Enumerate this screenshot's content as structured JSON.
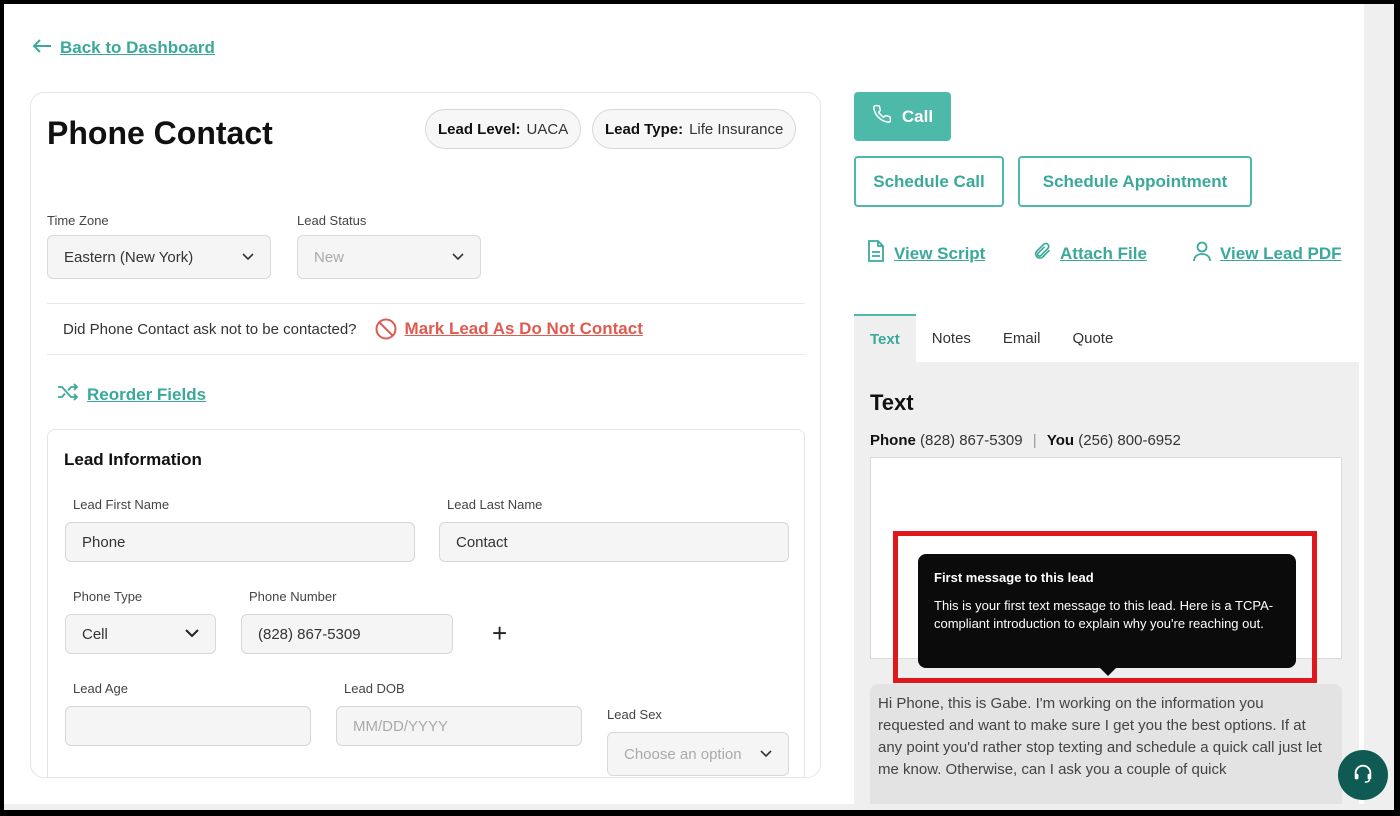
{
  "nav": {
    "back_label": "Back to Dashboard"
  },
  "lead": {
    "title": "Phone Contact",
    "level_label": "Lead Level:",
    "level_value": "UACA",
    "type_label": "Lead Type:",
    "type_value": "Life Insurance"
  },
  "fields": {
    "timezone_label": "Time Zone",
    "timezone_value": "Eastern (New York)",
    "status_label": "Lead Status",
    "status_value": "New"
  },
  "dnc": {
    "question": "Did Phone Contact ask not to be contacted?",
    "action": "Mark Lead As Do Not Contact"
  },
  "reorder_label": "Reorder Fields",
  "lead_info": {
    "title": "Lead Information",
    "first_name_label": "Lead First Name",
    "first_name_value": "Phone",
    "last_name_label": "Lead Last Name",
    "last_name_value": "Contact",
    "phone_type_label": "Phone Type",
    "phone_type_value": "Cell",
    "phone_number_label": "Phone Number",
    "phone_number_value": "(828) 867-5309",
    "add_phone": "+",
    "age_label": "Lead Age",
    "age_value": "",
    "dob_label": "Lead DOB",
    "dob_placeholder": "MM/DD/YYYY",
    "sex_label": "Lead Sex",
    "sex_placeholder": "Choose an option"
  },
  "actions": {
    "call": "Call",
    "schedule_call": "Schedule Call",
    "schedule_appointment": "Schedule Appointment",
    "view_script": "View Script",
    "attach_file": "Attach File",
    "view_lead_pdf": "View Lead PDF"
  },
  "tabs": [
    "Text",
    "Notes",
    "Email",
    "Quote"
  ],
  "text_panel": {
    "title": "Text",
    "phone_label": "Phone",
    "phone_value": "(828) 867-5309",
    "sep": "|",
    "you_label": "You",
    "you_value": "(256) 800-6952",
    "tooltip_title": "First message to this lead",
    "tooltip_body": "This is your first text message to this lead. Here is a TCPA-compliant introduction to explain why you're reaching out.",
    "suggested_message": "Hi Phone, this is Gabe. I'm working on the information you requested and want to make sure I get you the best options. If at any point you'd rather stop texting and schedule a quick call just let me know. Otherwise, can I ask you a couple of quick"
  },
  "colors": {
    "accent": "#3aa99a",
    "danger": "#e05a4f",
    "highlight": "#e0181b",
    "help": "#0f5a52"
  },
  "icons": [
    "arrow-left-icon",
    "ban-icon",
    "shuffle-icon",
    "phone-icon",
    "file-icon",
    "paperclip-icon",
    "user-icon",
    "headset-icon"
  ]
}
